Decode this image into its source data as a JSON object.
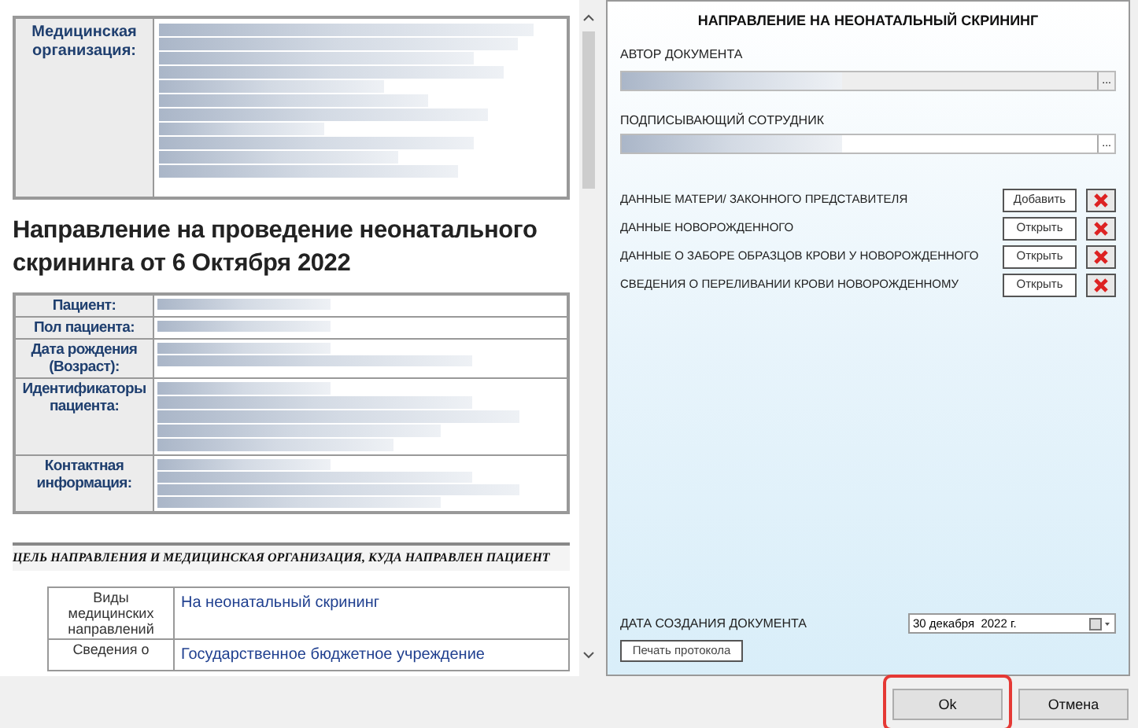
{
  "document": {
    "org_label": "Медицинская организация:",
    "title": "Направление на проведение неонатального скрининга от 6 Октября 2022",
    "patient_fields": [
      {
        "label": "Пациент:"
      },
      {
        "label": "Пол пациента:"
      },
      {
        "label": "Дата рождения (Возраст):"
      },
      {
        "label": "Идентификаторы пациента:"
      },
      {
        "label": "Контактная информация:"
      }
    ],
    "section_heading": "ЦЕЛЬ НАПРАВЛЕНИЯ И МЕДИЦИНСКАЯ ОРГАНИЗАЦИЯ, КУДА НАПРАВЛЕН ПАЦИЕНТ",
    "referral_rows": [
      {
        "label": "Виды медицинских направлений",
        "value": "На неонатальный скрининг"
      },
      {
        "label": "Сведения о",
        "value": "Государственное бюджетное учреждение"
      }
    ]
  },
  "form": {
    "title": "НАПРАВЛЕНИЕ НА НЕОНАТАЛЬНЫЙ СКРИНИНГ",
    "author_label": "АВТОР ДОКУМЕНТА",
    "signer_label": "ПОДПИСЫВАЮЩИЙ СОТРУДНИК",
    "browse_label": "...",
    "sections": [
      {
        "label": "ДАННЫЕ МАТЕРИ/ ЗАКОННОГО ПРЕДСТАВИТЕЛЯ",
        "button": "Добавить"
      },
      {
        "label": "ДАННЫЕ НОВОРОЖДЕННОГО",
        "button": "Открыть"
      },
      {
        "label": "ДАННЫЕ О ЗАБОРЕ ОБРАЗЦОВ КРОВИ У НОВОРОЖДЕННОГО",
        "button": "Открыть"
      },
      {
        "label": "СВЕДЕНИЯ О ПЕРЕЛИВАНИИ КРОВИ НОВОРОЖДЕННОМУ",
        "button": "Открыть"
      }
    ],
    "date_label": "ДАТА СОЗДАНИЯ ДОКУМЕНТА",
    "date_value": "30 декабря  2022 г.",
    "print_button": "Печать протокола"
  },
  "footer": {
    "buttons": [
      {
        "label": "Ok",
        "highlighted": true
      },
      {
        "label": "Отмена",
        "highlighted": false
      }
    ]
  }
}
